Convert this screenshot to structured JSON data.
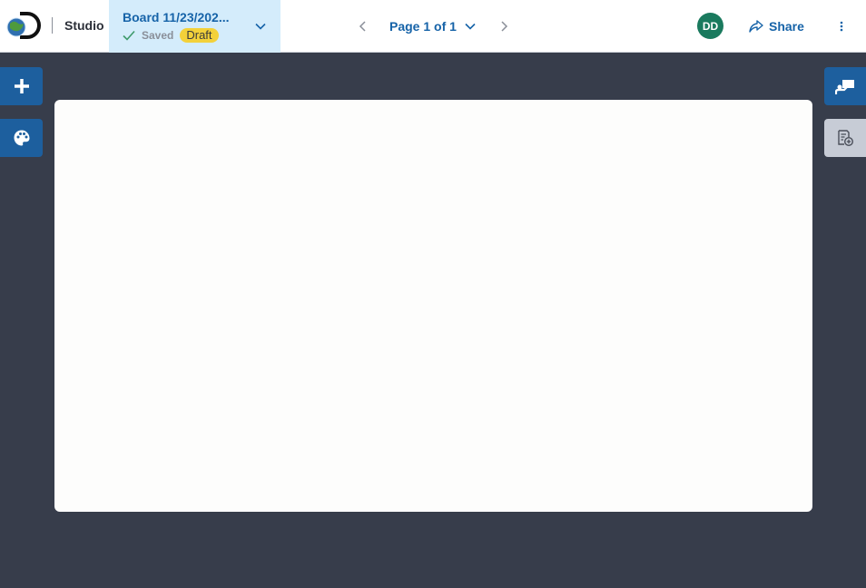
{
  "header": {
    "app_name": "Studio",
    "board": {
      "title": "Board 11/23/202...",
      "save_status": "Saved",
      "badge": "Draft"
    },
    "pagination": {
      "label": "Page 1 of 1"
    },
    "avatar_initials": "DD",
    "share_label": "Share"
  },
  "left_toolbar": {
    "items": [
      {
        "icon": "plus-icon"
      },
      {
        "icon": "palette-icon"
      }
    ]
  },
  "right_toolbar": {
    "items": [
      {
        "icon": "presenter-icon"
      },
      {
        "icon": "add-page-icon"
      }
    ]
  },
  "colors": {
    "brand_blue": "#1663a8",
    "canvas_bg": "#373d4b",
    "selector_bg": "#d4ecfb",
    "draft_badge": "#f3d13a",
    "avatar": "#1a7a5e"
  }
}
